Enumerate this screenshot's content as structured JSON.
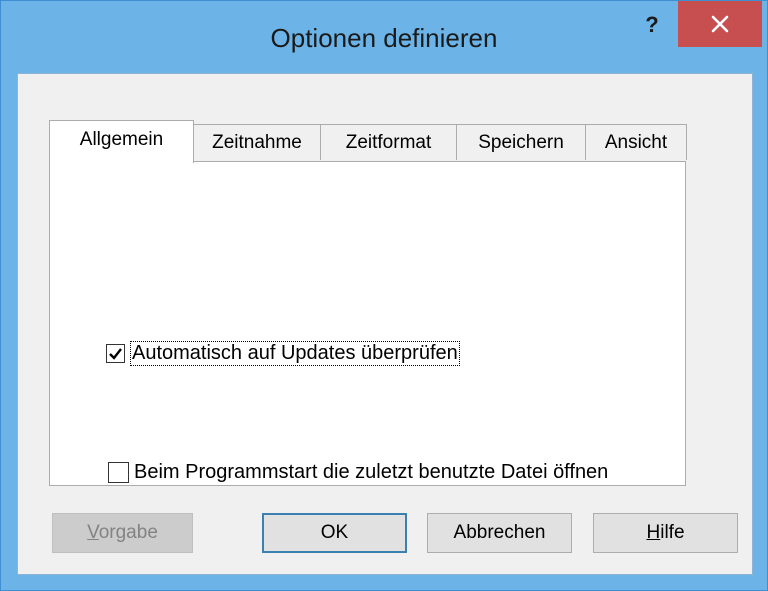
{
  "dialog": {
    "title": "Optionen definieren",
    "help_label": "?",
    "close_icon": "close-icon"
  },
  "tabs": [
    {
      "label": "Allgemein",
      "selected": true
    },
    {
      "label": "Zeitnahme",
      "selected": false
    },
    {
      "label": "Zeitformat",
      "selected": false
    },
    {
      "label": "Speichern",
      "selected": false
    },
    {
      "label": "Ansicht",
      "selected": false
    }
  ],
  "options": {
    "auto_update": {
      "label": "Automatisch auf Updates überprüfen",
      "checked": true
    },
    "open_last_file": {
      "label": "Beim Programmstart die zuletzt benutzte Datei öffnen",
      "checked": false
    }
  },
  "buttons": {
    "defaults": {
      "mnemonic": "V",
      "rest": "orgabe",
      "enabled": false
    },
    "ok": {
      "label": "OK"
    },
    "cancel": {
      "label": "Abbrechen"
    },
    "help": {
      "mnemonic": "H",
      "rest": "ilfe"
    }
  },
  "colors": {
    "title_bar": "#6cb4e8",
    "close_button": "#c74f4f",
    "dialog_background": "#f0f0f0",
    "default_button_border": "#3c7fb1"
  }
}
